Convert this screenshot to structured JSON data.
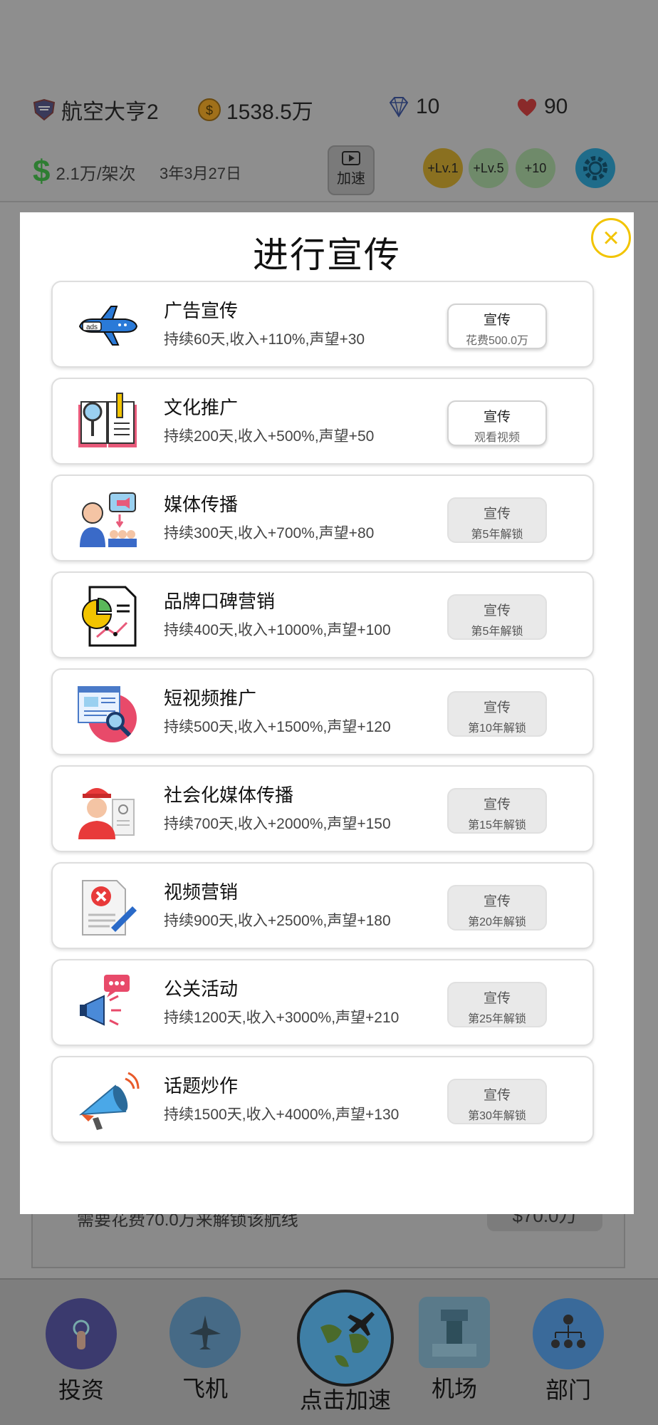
{
  "header": {
    "company_name": "航空大亨2",
    "coins": "1538.5万",
    "diamonds": "10",
    "hearts": "90",
    "income_rate": "2.1万/架次",
    "game_date": "3年3月27日",
    "speed_label": "加速",
    "boost_buttons": [
      "+Lv.1",
      "+Lv.5",
      "+10"
    ]
  },
  "background_card": {
    "text": "需要花费70.0万来解锁该航线",
    "button": "$70.0万"
  },
  "modal": {
    "title": "进行宣传",
    "items": [
      {
        "name": "广告宣传",
        "desc": "持续60天,收入+110%,声望+30",
        "btn_label": "宣传",
        "btn_sub": "花费500.0万",
        "state": "active",
        "icon": "ads-airplane-icon"
      },
      {
        "name": "文化推广",
        "desc": "持续200天,收入+500%,声望+50",
        "btn_label": "宣传",
        "btn_sub": "观看视频",
        "state": "active",
        "icon": "book-magnifier-icon"
      },
      {
        "name": "媒体传播",
        "desc": "持续300天,收入+700%,声望+80",
        "btn_label": "宣传",
        "btn_sub": "第5年解锁",
        "state": "locked",
        "icon": "media-speaker-icon"
      },
      {
        "name": "品牌口碑营销",
        "desc": "持续400天,收入+1000%,声望+100",
        "btn_label": "宣传",
        "btn_sub": "第5年解锁",
        "state": "locked",
        "icon": "report-chart-icon"
      },
      {
        "name": "短视频推广",
        "desc": "持续500天,收入+1500%,声望+120",
        "btn_label": "宣传",
        "btn_sub": "第10年解锁",
        "state": "locked",
        "icon": "web-search-icon"
      },
      {
        "name": "社会化媒体传播",
        "desc": "持续700天,收入+2000%,声望+150",
        "btn_label": "宣传",
        "btn_sub": "第15年解锁",
        "state": "locked",
        "icon": "worker-id-icon"
      },
      {
        "name": "视频营销",
        "desc": "持续900天,收入+2500%,声望+180",
        "btn_label": "宣传",
        "btn_sub": "第20年解锁",
        "state": "locked",
        "icon": "document-error-icon"
      },
      {
        "name": "公关活动",
        "desc": "持续1200天,收入+3000%,声望+210",
        "btn_label": "宣传",
        "btn_sub": "第25年解锁",
        "state": "locked",
        "icon": "megaphone-chat-icon"
      },
      {
        "name": "话题炒作",
        "desc": "持续1500天,收入+4000%,声望+130",
        "btn_label": "宣传",
        "btn_sub": "第30年解锁",
        "state": "locked",
        "icon": "megaphone-icon"
      }
    ]
  },
  "bottom_nav": [
    {
      "label": "投资"
    },
    {
      "label": "飞机"
    },
    {
      "label": "点击加速"
    },
    {
      "label": "机场"
    },
    {
      "label": "部门"
    }
  ]
}
